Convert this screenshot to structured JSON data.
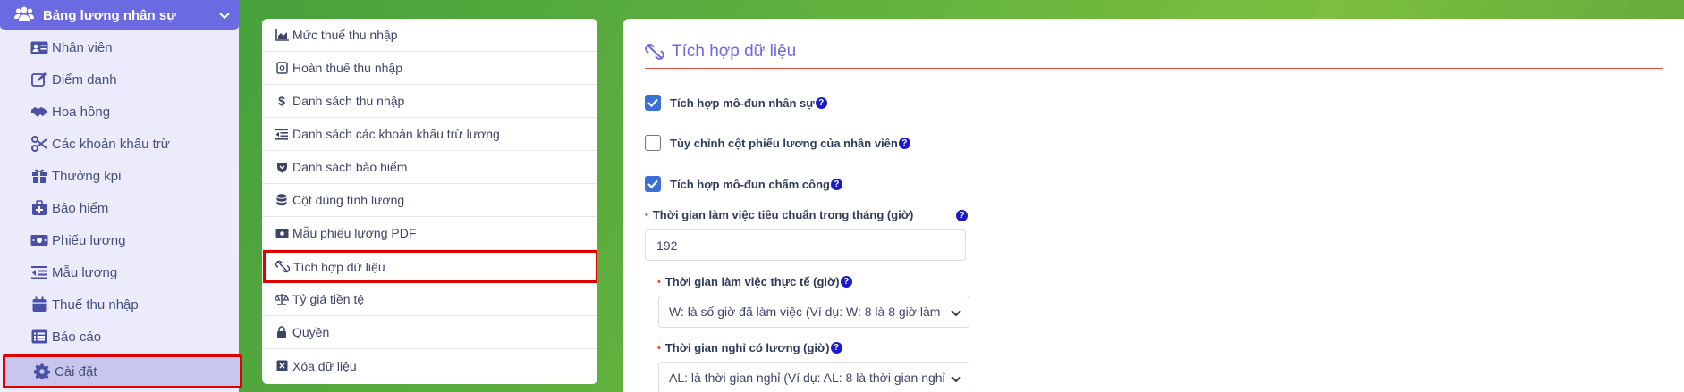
{
  "sidebar": {
    "header_label": "Bảng lương nhân sự",
    "items": [
      {
        "label": "Nhân viên",
        "icon": "id-card-icon"
      },
      {
        "label": "Điểm danh",
        "icon": "edit-icon"
      },
      {
        "label": "Hoa hồng",
        "icon": "handshake-icon"
      },
      {
        "label": "Các khoản khấu trừ",
        "icon": "scissors-icon"
      },
      {
        "label": "Thưởng kpi",
        "icon": "gift-icon"
      },
      {
        "label": "Bảo hiểm",
        "icon": "medical-kit-icon"
      },
      {
        "label": "Phiếu lương",
        "icon": "money-bill-icon"
      },
      {
        "label": "Mẫu lương",
        "icon": "list-indent-icon"
      },
      {
        "label": "Thuế thu nhập",
        "icon": "calendar-icon"
      },
      {
        "label": "Báo cáo",
        "icon": "list-icon"
      },
      {
        "label": "Cài đặt",
        "icon": "gear-icon"
      }
    ]
  },
  "menu": {
    "items": [
      {
        "label": "Mức thuế thu nhập",
        "icon": "chart-area-icon"
      },
      {
        "label": "Hoàn thuế thu nhập",
        "icon": "receipt-icon"
      },
      {
        "label": "Danh sách thu nhập",
        "icon": "dollar-icon"
      },
      {
        "label": "Danh sách các khoản khấu trừ lương",
        "icon": "list-indent-icon"
      },
      {
        "label": "Danh sách bảo hiểm",
        "icon": "shield-icon"
      },
      {
        "label": "Cột dùng tính lương",
        "icon": "database-icon"
      },
      {
        "label": "Mẫu phiếu lương PDF",
        "icon": "money-bill-icon"
      },
      {
        "label": "Tích hợp dữ liệu",
        "icon": "unlink-icon"
      },
      {
        "label": "Tỷ giá tiền tệ",
        "icon": "balance-scale-icon"
      },
      {
        "label": "Quyền",
        "icon": "lock-icon"
      },
      {
        "label": "Xóa dữ liệu",
        "icon": "close-box-icon"
      }
    ]
  },
  "panel": {
    "title": "Tích hợp dữ liệu",
    "checkboxes": [
      {
        "label": "Tích hợp mô-đun nhân sự",
        "checked": true
      },
      {
        "label": "Tùy chỉnh cột phiếu lương của nhân viên",
        "checked": false
      },
      {
        "label": "Tích hợp mô-đun chấm công",
        "checked": true
      }
    ],
    "standard_hours": {
      "label": "Thời gian làm việc tiêu chuẩn trong tháng (giờ)",
      "value": "192"
    },
    "actual_hours": {
      "label": "Thời gian làm việc thực tế (giờ)",
      "selected": "W: là số giờ đã làm việc (Ví dụ: W: 8 là 8 giờ làm"
    },
    "paid_leave": {
      "label": "Thời gian nghỉ có lương (giờ)",
      "selected": "AL: là thời gian nghỉ (Ví dụ: AL: 8 là thời gian nghỉ"
    },
    "help_glyph": "?"
  },
  "colors": {
    "accent": "#6c6ae0",
    "highlight": "#e00000",
    "checkbox": "#3b6fd6",
    "help": "#1a1ac8"
  }
}
